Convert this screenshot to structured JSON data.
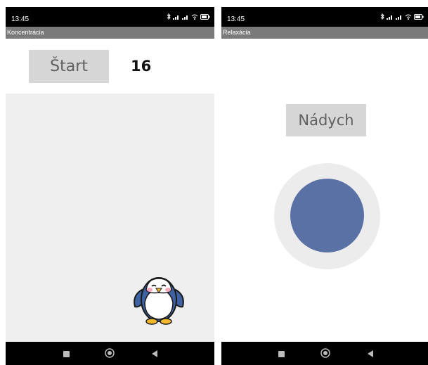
{
  "screens": [
    {
      "status_time": "13:45",
      "title": "Koncentrácia",
      "start_label": "Štart",
      "counter_value": "16",
      "mascot_icon": "penguin-icon"
    },
    {
      "status_time": "13:45",
      "title": "Relaxácia",
      "breath_label": "Nádych",
      "breath_circle_color": "#5a71a5"
    }
  ],
  "navbar_icons": [
    "recents-icon",
    "home-icon",
    "back-icon"
  ]
}
